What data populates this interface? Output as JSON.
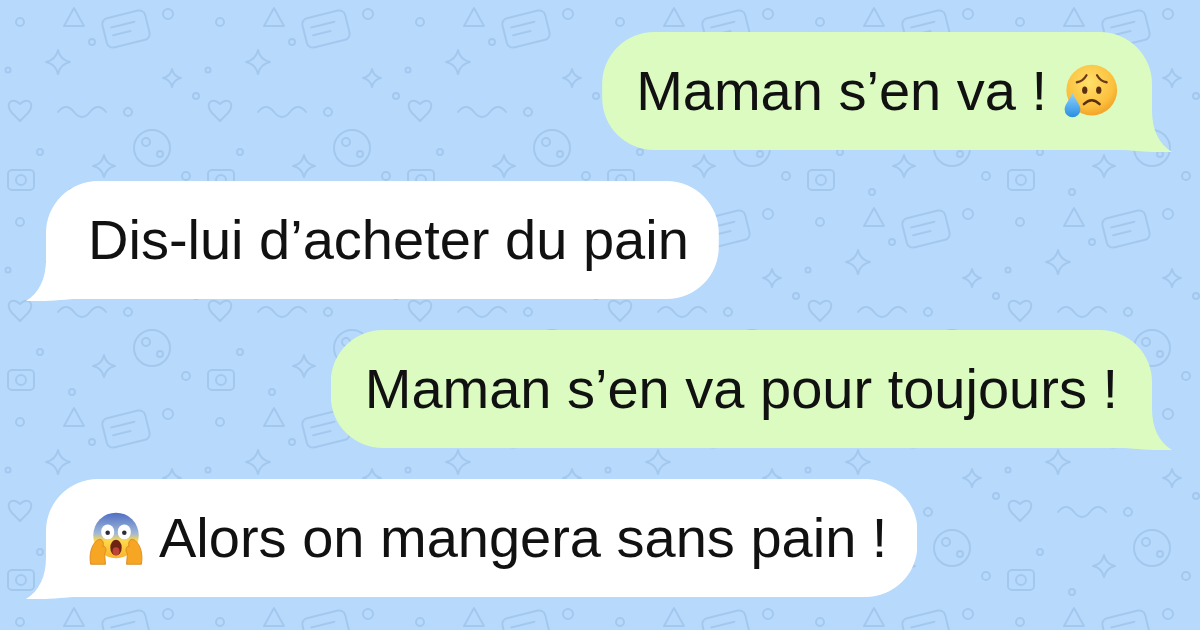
{
  "messages": [
    {
      "kind": "sent",
      "text": "Maman s’en va !",
      "emoji_after": {
        "kind": "sad-sweat"
      }
    },
    {
      "kind": "received",
      "text": "Dis-lui d’acheter du pain"
    },
    {
      "kind": "sent",
      "text": "Maman s’en va pour toujours !"
    },
    {
      "kind": "received",
      "text": "Alors on mangera sans pain !",
      "emoji_before": {
        "kind": "scream"
      }
    }
  ]
}
